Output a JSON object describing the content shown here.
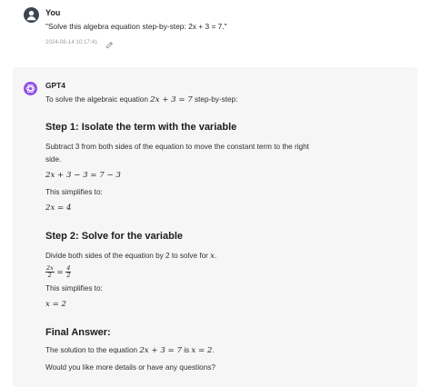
{
  "user": {
    "name": "You",
    "message": "\"Solve this algebra equation step-by-step: 2x + 3 = 7.\"",
    "timestamp": "2024-08-14 10:17:41"
  },
  "assistant": {
    "name": "GPT4",
    "intro_prefix": "To solve the algebraic equation",
    "intro_math": "2x + 3 = 7",
    "intro_suffix": "step-by-step:",
    "step1": {
      "heading": "Step 1: Isolate the term with the variable",
      "text_line1": "Subtract 3 from both sides of the equation to move the constant term to the right",
      "text_line2": "side.",
      "eq1": "2x + 3 − 3 = 7 − 3",
      "simplifies": "This simplifies to:",
      "eq2": "2x = 4"
    },
    "step2": {
      "heading": "Step 2: Solve for the variable",
      "text_prefix": "Divide both sides of the equation by 2 to solve for",
      "text_var": "x",
      "text_suffix": ".",
      "frac_left_num": "2x",
      "frac_left_den": "2",
      "frac_eq": "=",
      "frac_right_num": "4",
      "frac_right_den": "2",
      "simplifies": "This simplifies to:",
      "eq": "x = 2"
    },
    "final": {
      "heading": "Final Answer:",
      "answer_prefix": "The solution to the equation",
      "answer_eq": "2x + 3 = 7",
      "answer_mid": "is",
      "answer_val": "x = 2",
      "answer_suffix": ".",
      "followup": "Would you like more details or have any questions?"
    }
  },
  "colors": {
    "user_avatar": "#3d4451",
    "bot_avatar": "#8f4fe8",
    "bot_bubble": "#f6f6f7"
  },
  "icons": {
    "user_avatar": "user-icon",
    "bot_avatar": "openai-logo-icon",
    "edit": "pencil-icon"
  }
}
